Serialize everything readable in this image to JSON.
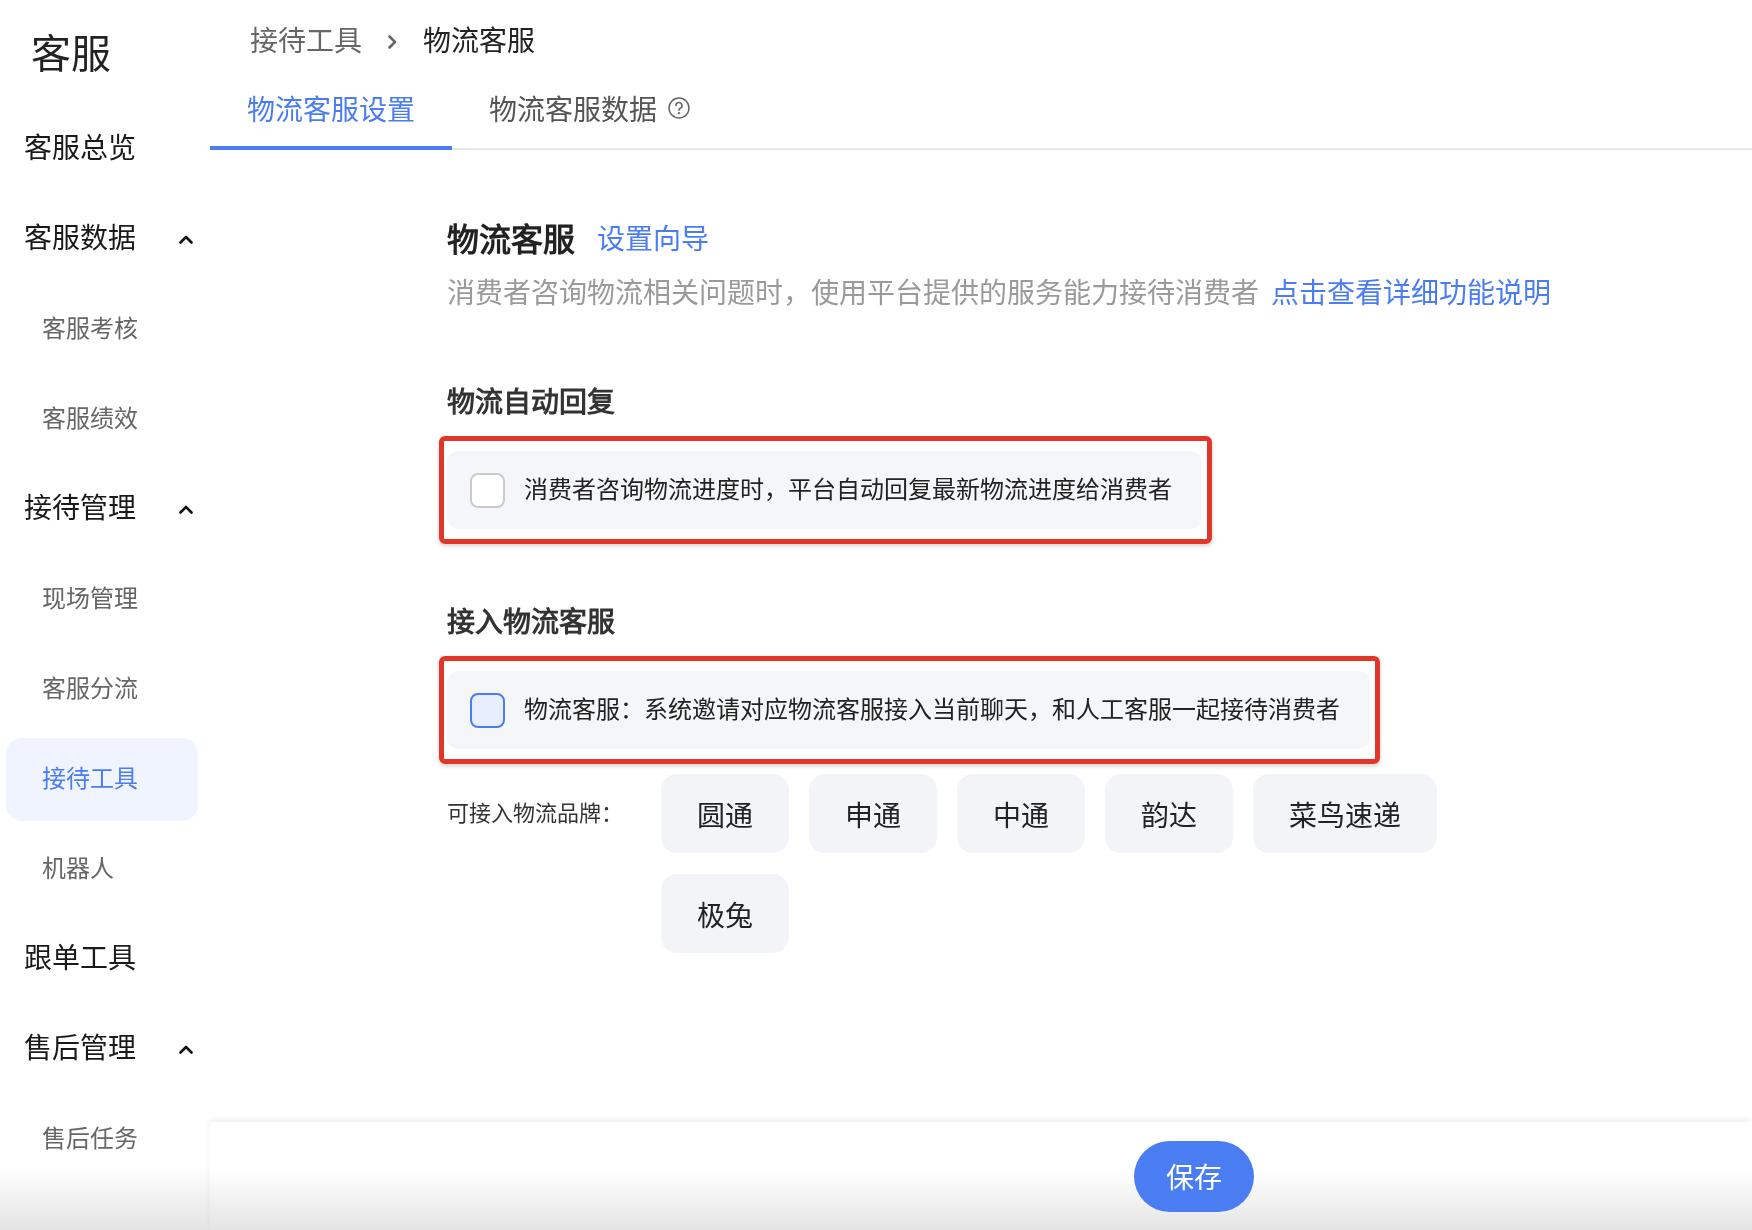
{
  "sidebar": {
    "title": "客服",
    "items": [
      {
        "label": "客服总览",
        "selected": false
      },
      {
        "label": "客服数据",
        "selected": false,
        "expanded": true,
        "children": [
          {
            "label": "客服考核",
            "selected": false
          },
          {
            "label": "客服绩效",
            "selected": false
          }
        ]
      },
      {
        "label": "接待管理",
        "selected": false,
        "expanded": true,
        "children": [
          {
            "label": "现场管理",
            "selected": false
          },
          {
            "label": "客服分流",
            "selected": false
          },
          {
            "label": "接待工具",
            "selected": true
          },
          {
            "label": "机器人",
            "selected": false
          }
        ]
      },
      {
        "label": "跟单工具",
        "selected": false
      },
      {
        "label": "售后管理",
        "selected": false,
        "expanded": true,
        "children": [
          {
            "label": "售后任务",
            "selected": false
          }
        ]
      }
    ]
  },
  "breadcrumb": [
    {
      "label": "接待工具",
      "current": false
    },
    {
      "label": "物流客服",
      "current": true
    }
  ],
  "tabs": [
    {
      "label": "物流客服设置",
      "selected": true,
      "help": false
    },
    {
      "label": "物流客服数据",
      "selected": false,
      "help": true
    }
  ],
  "header": {
    "title": "物流客服",
    "guide_link": "设置向导",
    "description": "消费者咨询物流相关问题时，使用平台提供的服务能力接待消费者",
    "detail_link": "点击查看详细功能说明"
  },
  "sections": [
    {
      "title": "物流自动回复",
      "option": {
        "label": "消费者咨询物流进度时，平台自动回复最新物流进度给消费者",
        "checked": false,
        "hovered": false,
        "highlighted": true
      }
    },
    {
      "title": "接入物流客服",
      "option": {
        "label": "物流客服：系统邀请对应物流客服接入当前聊天，和人工客服一起接待消费者",
        "checked": false,
        "hovered": true,
        "highlighted": true
      },
      "brands_label": "可接入物流品牌：",
      "brands": [
        "圆通",
        "申通",
        "中通",
        "韵达",
        "菜鸟速递",
        "极兔"
      ]
    }
  ],
  "footer": {
    "save_button": "保存"
  }
}
